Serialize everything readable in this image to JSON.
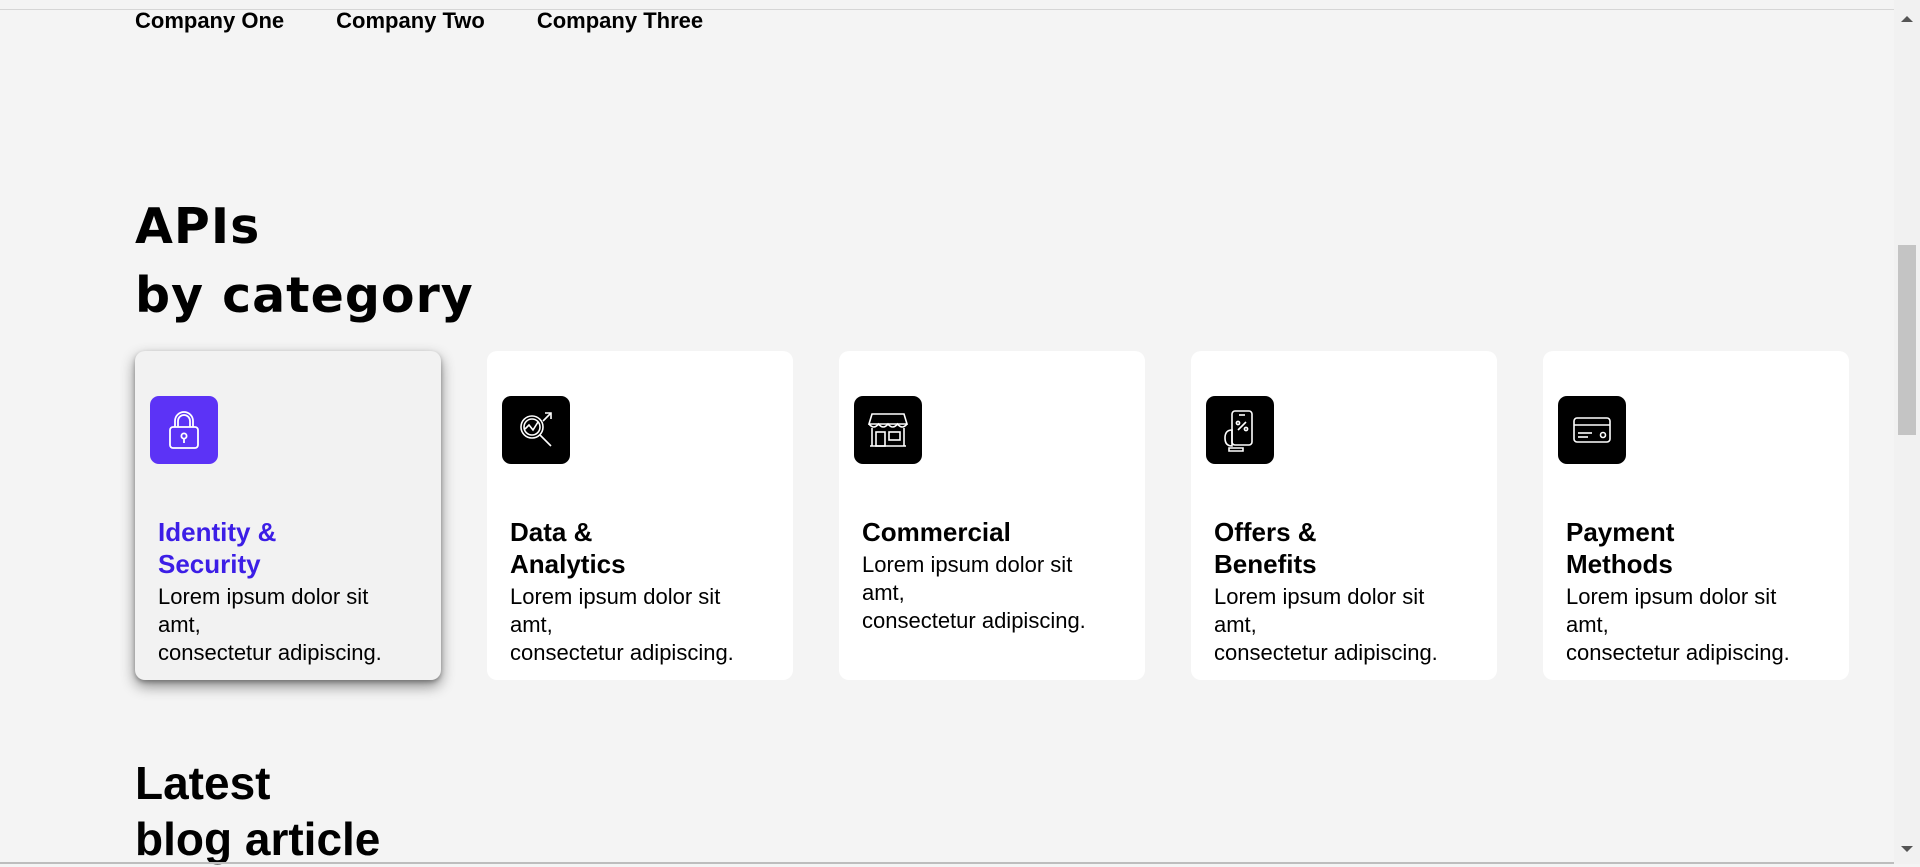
{
  "nav": {
    "companies": [
      "Company One",
      "Company Two",
      "Company Three"
    ]
  },
  "section": {
    "heading_line1": "APIs",
    "heading_line2": "by category"
  },
  "categories": [
    {
      "title": "Identity & Security",
      "title_line1": "Identity &",
      "title_line2": "Security",
      "icon": "lock-icon",
      "active": true,
      "desc_line1": "Lorem ipsum dolor sit",
      "desc_line2": "amt,",
      "desc_line3": "consectetur adipiscing."
    },
    {
      "title": "Data & Analytics",
      "title_line1": "Data &",
      "title_line2": "Analytics",
      "icon": "analytics-search-icon",
      "active": false,
      "desc_line1": "Lorem ipsum dolor sit",
      "desc_line2": "amt,",
      "desc_line3": "consectetur adipiscing."
    },
    {
      "title": "Commercial",
      "title_line1": "Commercial",
      "title_line2": "",
      "icon": "storefront-icon",
      "active": false,
      "desc_line1": "Lorem ipsum dolor sit",
      "desc_line2": "amt,",
      "desc_line3": "consectetur adipiscing."
    },
    {
      "title": "Offers & Benefits",
      "title_line1": "Offers &",
      "title_line2": "Benefits",
      "icon": "mobile-offer-icon",
      "active": false,
      "desc_line1": "Lorem ipsum dolor sit",
      "desc_line2": "amt,",
      "desc_line3": "consectetur adipiscing."
    },
    {
      "title": "Payment Methods",
      "title_line1": "Payment",
      "title_line2": "Methods",
      "icon": "credit-card-icon",
      "active": false,
      "desc_line1": "Lorem ipsum dolor sit",
      "desc_line2": "amt,",
      "desc_line3": "consectetur adipiscing."
    }
  ],
  "blog": {
    "heading_line1": "Latest",
    "heading_line2": "blog article"
  },
  "colors": {
    "accent": "#5c33f6",
    "accent_text": "#3c1ee6",
    "background": "#f4f4f4",
    "card": "#ffffff",
    "icon_bg": "#000000"
  }
}
